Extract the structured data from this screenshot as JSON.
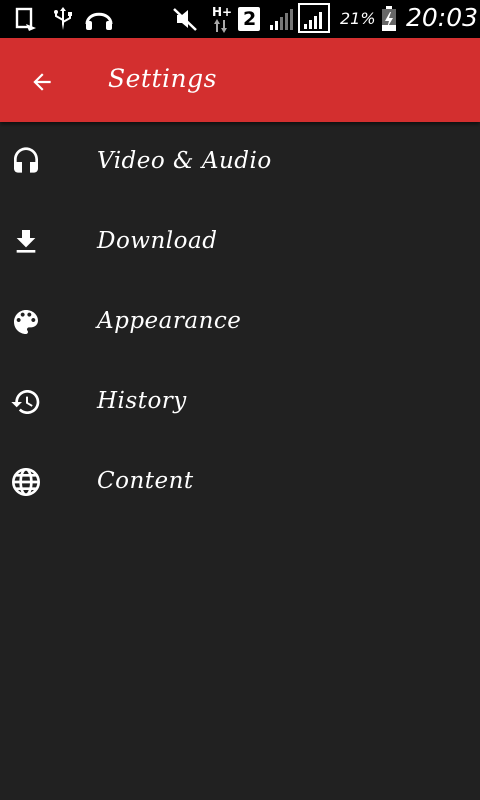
{
  "status_bar": {
    "network_type": "H+",
    "sim_slot": "2",
    "battery_percent": "21%",
    "time": "20:03"
  },
  "app_bar": {
    "title": "Settings",
    "background_color": "#d32f2f"
  },
  "menu": {
    "items": [
      {
        "label": "Video & Audio",
        "icon": "headphones-icon"
      },
      {
        "label": "Download",
        "icon": "download-icon"
      },
      {
        "label": "Appearance",
        "icon": "palette-icon"
      },
      {
        "label": "History",
        "icon": "history-icon"
      },
      {
        "label": "Content",
        "icon": "globe-icon"
      }
    ]
  }
}
